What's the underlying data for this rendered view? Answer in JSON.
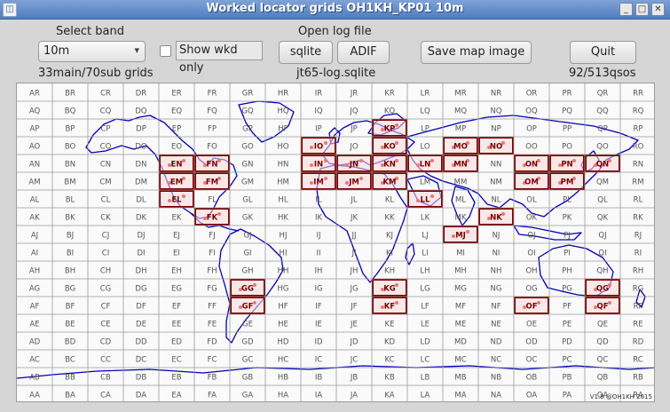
{
  "window": {
    "title": "Worked locator grids OH1KH_KP01 10m",
    "icon": "app-icon"
  },
  "controls": {
    "select_band_label": "Select band",
    "band_value": "10m",
    "show_wkd_only": "Show wkd only",
    "grid_counts": "33main/70sub grids",
    "open_log_label": "Open log file",
    "sqlite_button": "sqlite",
    "adif_button": "ADIF",
    "log_filename": "jt65-log.sqlite",
    "save_map_button": "Save map image",
    "quit_button": "Quit",
    "qso_counts": "92/513qsos"
  },
  "map": {
    "credit": "V1.8 @OH1KH 2015",
    "columns": [
      "A",
      "B",
      "C",
      "D",
      "E",
      "F",
      "G",
      "H",
      "I",
      "J",
      "K",
      "L",
      "M",
      "N",
      "O",
      "P",
      "Q",
      "R"
    ],
    "rows": [
      "R",
      "Q",
      "P",
      "O",
      "N",
      "M",
      "L",
      "K",
      "J",
      "I",
      "H",
      "G",
      "F",
      "E",
      "D",
      "C",
      "B",
      "A"
    ],
    "worked": [
      "KP",
      "KO",
      "IO",
      "MO",
      "NO",
      "EN",
      "FN",
      "IN",
      "JN",
      "KN",
      "LN",
      "MN",
      "ON",
      "PN",
      "QN",
      "EM",
      "FM",
      "IM",
      "JM",
      "KM",
      "OM",
      "PM",
      "EL",
      "LL",
      "FK",
      "NK",
      "MJ",
      "GG",
      "KG",
      "QG",
      "GF",
      "KF",
      "OF",
      "QF"
    ],
    "colors": {
      "grid_line": "#9a9a9a",
      "label": "#555555",
      "worked_border": "#7a0000",
      "worked_fill": "#f7d9d9",
      "coast": "#0000b4",
      "spot": "#e00000"
    }
  }
}
